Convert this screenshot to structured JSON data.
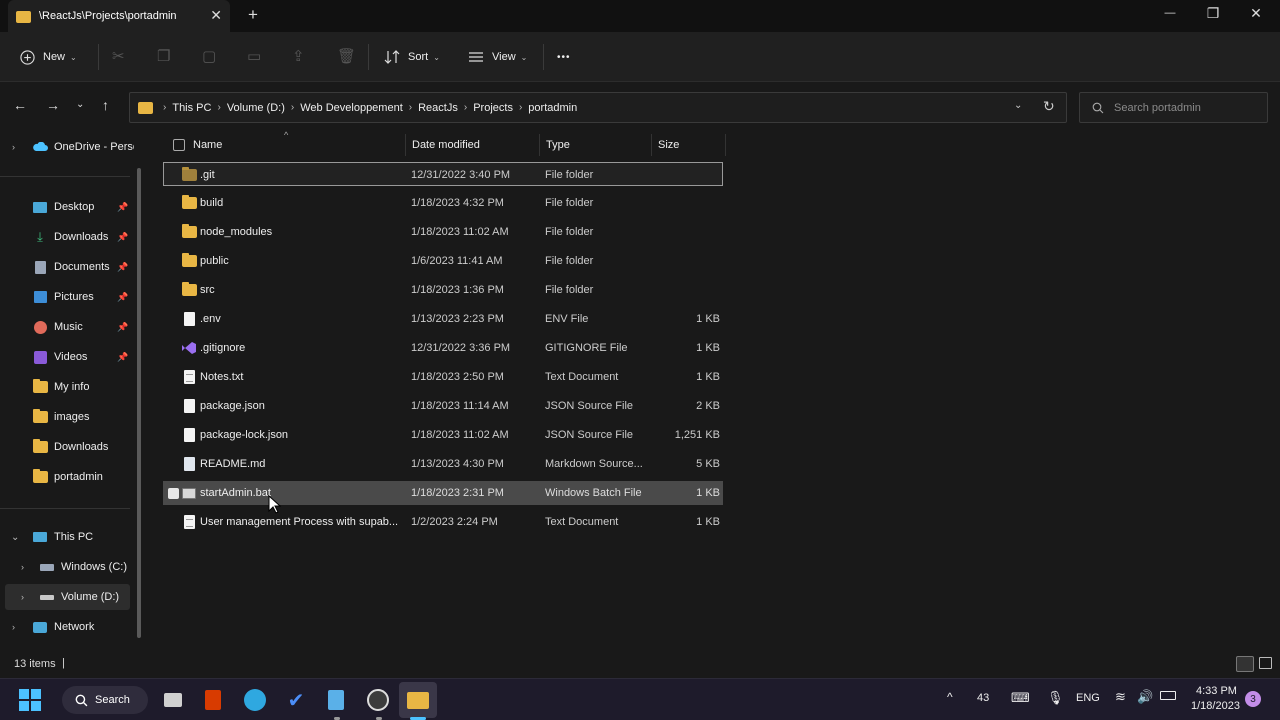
{
  "window": {
    "tab_title": "\\ReactJs\\Projects\\portadmin",
    "tab_close": "✕",
    "new_tab": "+",
    "minimize": "—",
    "maximize": "❐",
    "close": "✕"
  },
  "toolbar": {
    "new_label": "New",
    "sort_label": "Sort",
    "view_label": "View",
    "more_label": "•••"
  },
  "address": {
    "crumbs": [
      "This PC",
      "Volume (D:)",
      "Web Developpement",
      "ReactJs",
      "Projects",
      "portadmin"
    ],
    "search_placeholder": "Search portadmin"
  },
  "sidebar": {
    "items": [
      {
        "label": "OneDrive - Perso"
      },
      {
        "label": "Desktop"
      },
      {
        "label": "Downloads"
      },
      {
        "label": "Documents"
      },
      {
        "label": "Pictures"
      },
      {
        "label": "Music"
      },
      {
        "label": "Videos"
      },
      {
        "label": "My info"
      },
      {
        "label": "images"
      },
      {
        "label": "Downloads"
      },
      {
        "label": "portadmin"
      },
      {
        "label": "This PC"
      },
      {
        "label": "Windows (C:)"
      },
      {
        "label": "Volume (D:)"
      },
      {
        "label": "Network"
      }
    ]
  },
  "columns": {
    "name": "Name",
    "date": "Date modified",
    "type": "Type",
    "size": "Size"
  },
  "files": [
    {
      "name": ".git",
      "date": "12/31/2022 3:40 PM",
      "type": "File folder",
      "size": "",
      "icon": "folder-icon"
    },
    {
      "name": "build",
      "date": "1/18/2023 4:32 PM",
      "type": "File folder",
      "size": "",
      "icon": "folder-icon"
    },
    {
      "name": "node_modules",
      "date": "1/18/2023 11:02 AM",
      "type": "File folder",
      "size": "",
      "icon": "folder-icon"
    },
    {
      "name": "public",
      "date": "1/6/2023 11:41 AM",
      "type": "File folder",
      "size": "",
      "icon": "folder-icon"
    },
    {
      "name": "src",
      "date": "1/18/2023 1:36 PM",
      "type": "File folder",
      "size": "",
      "icon": "folder-icon"
    },
    {
      "name": ".env",
      "date": "1/13/2023 2:23 PM",
      "type": "ENV File",
      "size": "1 KB",
      "icon": "file-icon"
    },
    {
      "name": ".gitignore",
      "date": "12/31/2022 3:36 PM",
      "type": "GITIGNORE File",
      "size": "1 KB",
      "icon": "visual-studio-icon"
    },
    {
      "name": "Notes.txt",
      "date": "1/18/2023 2:50 PM",
      "type": "Text Document",
      "size": "1 KB",
      "icon": "text-file-icon"
    },
    {
      "name": "package.json",
      "date": "1/18/2023 11:14 AM",
      "type": "JSON Source File",
      "size": "2 KB",
      "icon": "file-icon"
    },
    {
      "name": "package-lock.json",
      "date": "1/18/2023 11:02 AM",
      "type": "JSON Source File",
      "size": "1,251 KB",
      "icon": "file-icon"
    },
    {
      "name": "README.md",
      "date": "1/13/2023 4:30 PM",
      "type": "Markdown Source...",
      "size": "5 KB",
      "icon": "markdown-file-icon"
    },
    {
      "name": "startAdmin.bat",
      "date": "1/18/2023 2:31 PM",
      "type": "Windows Batch File",
      "size": "1 KB",
      "icon": "batch-file-icon"
    },
    {
      "name": "User management Process with supab...",
      "date": "1/2/2023 2:24 PM",
      "type": "Text Document",
      "size": "1 KB",
      "icon": "text-file-icon"
    }
  ],
  "status": {
    "item_count": "13 items",
    "cursor": "|"
  },
  "taskbar": {
    "search_label": "Search",
    "weather_temp": "43",
    "language": "ENG",
    "time": "4:33 PM",
    "date": "1/18/2023",
    "notification_count": "3"
  },
  "colors": {
    "folder": "#e8b644",
    "accent": "#4cc2ff",
    "background": "#191919",
    "selection": "#4a4a4a"
  }
}
